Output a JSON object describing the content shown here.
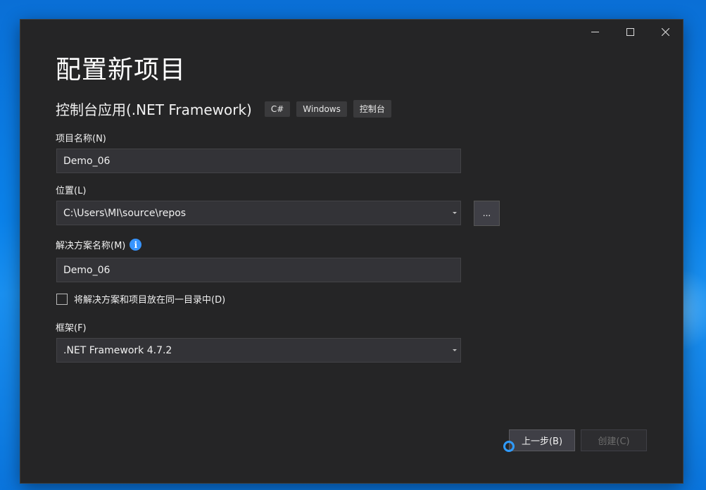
{
  "window": {
    "minimize_icon": "minimize-icon",
    "maximize_icon": "maximize-icon",
    "close_icon": "close-icon"
  },
  "page": {
    "title": "配置新项目"
  },
  "template": {
    "name": "控制台应用(.NET Framework)",
    "tags": [
      "C#",
      "Windows",
      "控制台"
    ]
  },
  "project_name": {
    "label": "项目名称(N)",
    "value": "Demo_06"
  },
  "location": {
    "label": "位置(L)",
    "value": "C:\\Users\\MI\\source\\repos",
    "browse_label": "..."
  },
  "solution_name": {
    "label": "解决方案名称(M)",
    "info_icon": "i",
    "value": "Demo_06"
  },
  "same_directory": {
    "label": "将解决方案和项目放在同一目录中(D)",
    "checked": false
  },
  "framework": {
    "label": "框架(F)",
    "value": ".NET Framework 4.7.2"
  },
  "buttons": {
    "back_label": "上一步(B)",
    "create_label": "创建(C)"
  },
  "colors": {
    "dialog_bg": "#252526",
    "input_bg": "#333337",
    "accent": "#3794ff"
  }
}
